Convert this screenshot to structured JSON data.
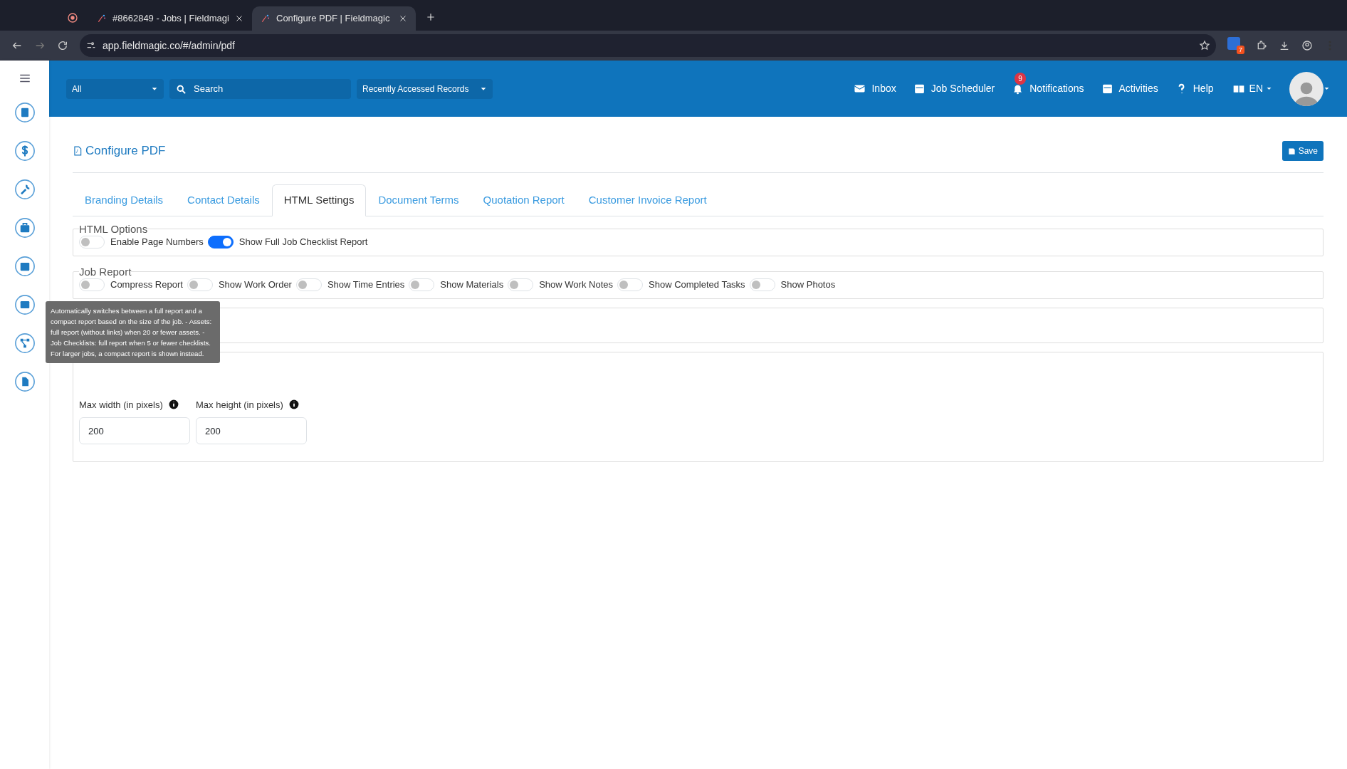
{
  "browser": {
    "tabs": [
      {
        "title": "#8662849 - Jobs | Fieldmagi",
        "selected": false
      },
      {
        "title": "Configure PDF | Fieldmagic",
        "selected": true
      }
    ],
    "url": "app.fieldmagic.co/#/admin/pdf",
    "extension_badge": "7"
  },
  "header": {
    "scope": "All",
    "search": {
      "placeholder": "Search"
    },
    "recent": "Recently Accessed Records",
    "nav": [
      {
        "kind": "inbox",
        "label": "Inbox"
      },
      {
        "kind": "calendar",
        "label": "Job Scheduler"
      },
      {
        "kind": "bell",
        "label": "Notifications",
        "badge": "9"
      },
      {
        "kind": "activities",
        "label": "Activities"
      },
      {
        "kind": "help",
        "label": "Help"
      }
    ],
    "language": "EN"
  },
  "page": {
    "title": "Configure PDF",
    "save": "Save",
    "tabs": [
      {
        "label": "Branding Details",
        "selected": false
      },
      {
        "label": "Contact Details",
        "selected": false
      },
      {
        "label": "HTML Settings",
        "selected": true
      },
      {
        "label": "Document Terms",
        "selected": false
      },
      {
        "label": "Quotation Report",
        "selected": false
      },
      {
        "label": "Customer Invoice Report",
        "selected": false
      }
    ],
    "sections": [
      {
        "legend": "HTML Options",
        "switches": [
          {
            "label": "Enable Page Numbers",
            "on": false
          },
          {
            "label": "Show Full Job Checklist Report",
            "on": true
          }
        ]
      },
      {
        "legend": "Job Report",
        "switches": [
          {
            "label": "Compress Report",
            "on": false
          },
          {
            "label": "Show Work Order",
            "on": false
          },
          {
            "label": "Show Time Entries",
            "on": false
          },
          {
            "label": "Show Materials",
            "on": false
          },
          {
            "label": "Show Work Notes",
            "on": false
          },
          {
            "label": "Show Completed Tasks",
            "on": false
          },
          {
            "label": "Show Photos",
            "on": false
          }
        ]
      },
      {
        "kind": "covered"
      },
      {
        "fields": [
          {
            "label": "Max width (in pixels)",
            "value": "200"
          },
          {
            "label": "Max height (in pixels)",
            "value": "200"
          }
        ]
      }
    ],
    "tooltip": "Automatically switches between a full report and a compact report based on the size of the job. - Assets: full report (without links) when 20 or fewer assets. - Job Checklists: full report when 5 or fewer checklists. For larger jobs, a compact report is shown instead."
  }
}
